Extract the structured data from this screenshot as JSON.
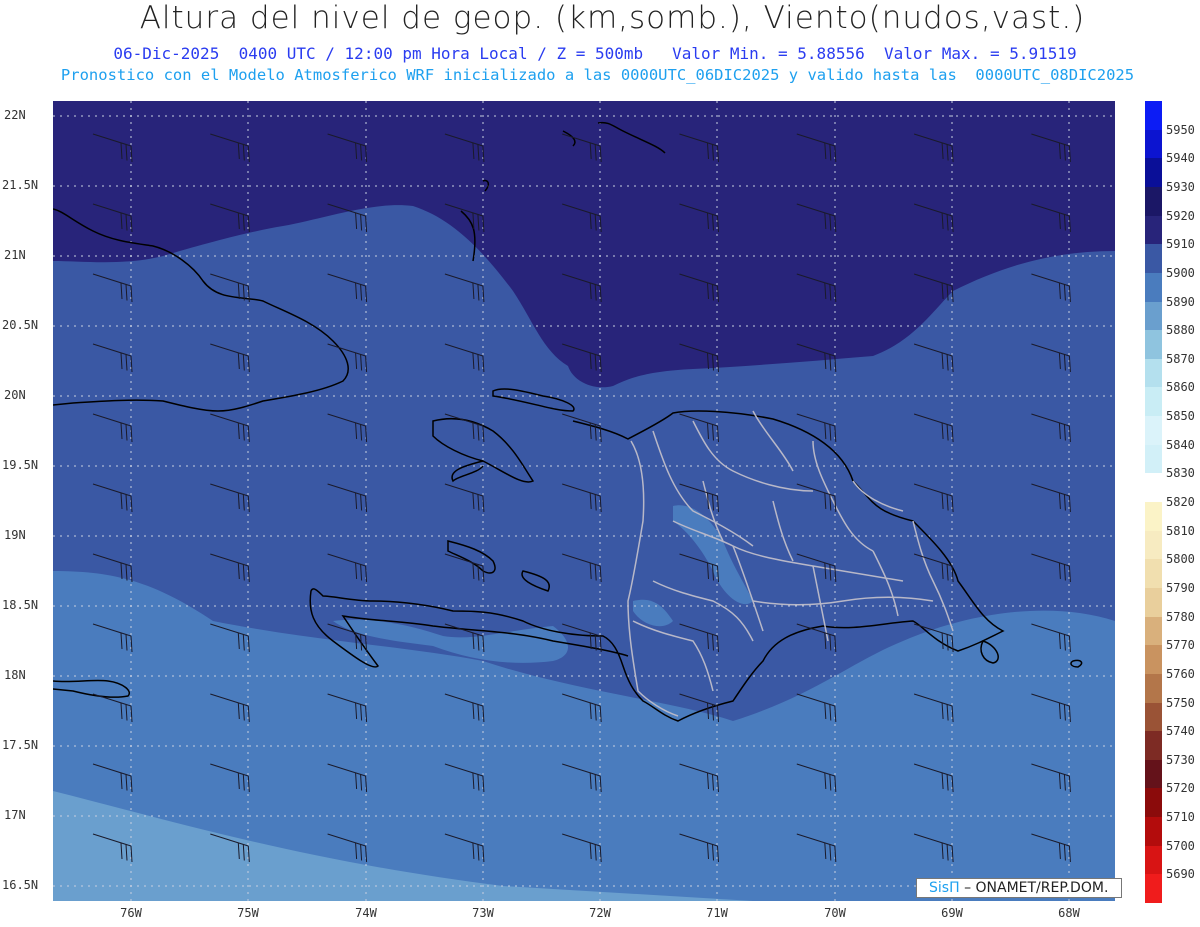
{
  "title": "Altura del nivel de geop. (km,somb.), Viento(nudos,vast.)",
  "subtitle_line1": "06-Dic-2025  0400 UTC / 12:00 pm Hora Local / Z = 500mb   Valor Min. = 5.88556  Valor Max. = 5.91519",
  "subtitle_line2": "Pronostico con el Modelo Atmosferico WRF inicializado a las 0000UTC_06DIC2025 y valido hasta las  0000UTC_08DIC2025",
  "lat_labels": [
    "22N",
    "21.5N",
    "21N",
    "20.5N",
    "20N",
    "19.5N",
    "19N",
    "18.5N",
    "18N",
    "17.5N",
    "17N",
    "16.5N"
  ],
  "lon_labels": [
    "76W",
    "75W",
    "74W",
    "73W",
    "72W",
    "71W",
    "70W",
    "69W",
    "68W"
  ],
  "colorbar": {
    "levels": [
      "5950",
      "5940",
      "5930",
      "5920",
      "5910",
      "5900",
      "5890",
      "5880",
      "5870",
      "5860",
      "5850",
      "5840",
      "5830",
      "5820",
      "5810",
      "5800",
      "5790",
      "5780",
      "5770",
      "5760",
      "5750",
      "5740",
      "5730",
      "5720",
      "5710",
      "5700",
      "5690"
    ],
    "colors": [
      "#0c1cf5",
      "#0c14d0",
      "#0a0f98",
      "#1b1766",
      "#28247a",
      "#3a58a4",
      "#4a7cbe",
      "#6a9fce",
      "#8fc4df",
      "#b4e0ee",
      "#c9edf5",
      "#dbf3fa",
      "#d2f0f8",
      "#ffffff",
      "#fbf3c7",
      "#f7ebc1",
      "#f1dfaf",
      "#e9cf9c",
      "#d9b07c",
      "#c99360",
      "#b3764a",
      "#9a5336",
      "#7d2b24",
      "#64121a",
      "#8b0b0b",
      "#b30c0c",
      "#d81414",
      "#f01c1c"
    ]
  },
  "credit": {
    "logo": "SisΠ",
    "text": "– ONAMET/REP.DOM."
  },
  "chart_data": {
    "type": "heatmap",
    "field": "500mb geopotential height (m)",
    "value_min_km": 5.88556,
    "value_max_km": 5.91519,
    "lon_range_w": [
      76.6,
      67.6
    ],
    "lat_range_n": [
      16.4,
      22.1
    ],
    "grid": true,
    "wind_barbs": true
  }
}
